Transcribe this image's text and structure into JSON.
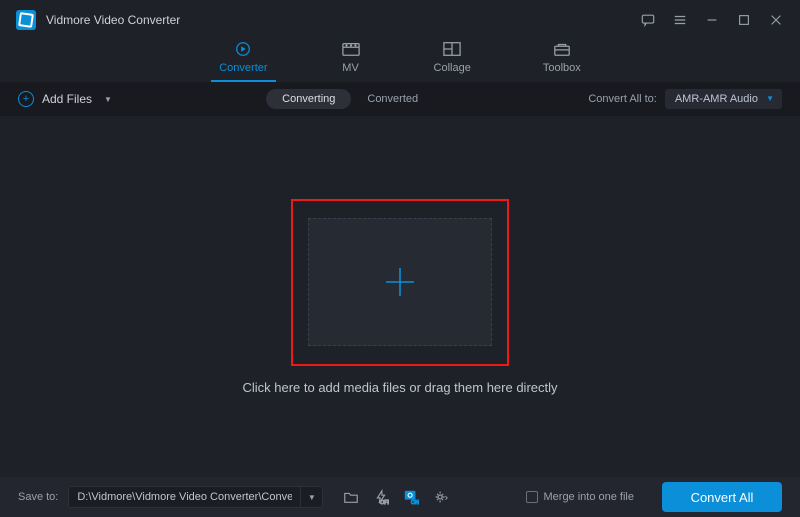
{
  "titlebar": {
    "title": "Vidmore Video Converter"
  },
  "nav": {
    "items": [
      {
        "label": "Converter"
      },
      {
        "label": "MV"
      },
      {
        "label": "Collage"
      },
      {
        "label": "Toolbox"
      }
    ]
  },
  "subbar": {
    "add_files_label": "Add Files",
    "segmented": {
      "converting": "Converting",
      "converted": "Converted"
    },
    "convert_all_label": "Convert All to:",
    "format_selected": "AMR-AMR Audio"
  },
  "main": {
    "drop_hint": "Click here to add media files or drag them here directly"
  },
  "footer": {
    "save_to_label": "Save to:",
    "save_path": "D:\\Vidmore\\Vidmore Video Converter\\Converted",
    "merge_label": "Merge into one file",
    "convert_button": "Convert All"
  }
}
